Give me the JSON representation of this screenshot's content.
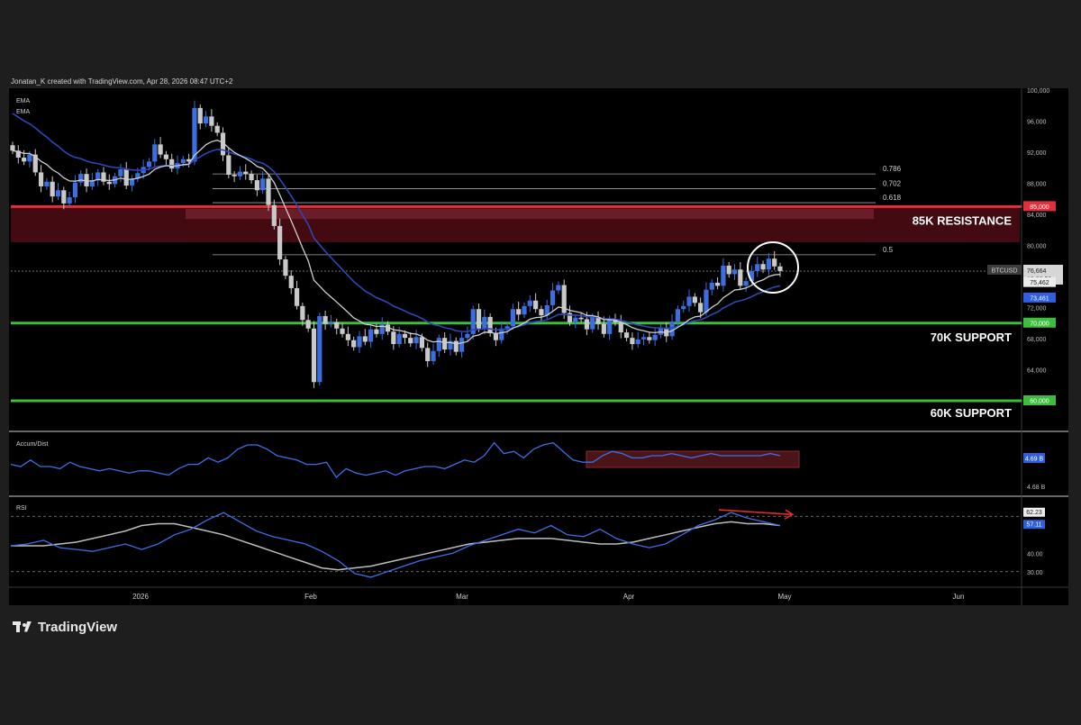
{
  "header": {
    "attribution": "Jonatan_K created with TradingView.com, Apr 28, 2026 08:47 UTC+2",
    "ema1_label": "EMA",
    "ema2_label": "EMA"
  },
  "brand": {
    "name": "TradingView"
  },
  "colors": {
    "background": "#000000",
    "frame": "#1e1e1f",
    "up": "#3b6fe0",
    "down": "#c9c9c9",
    "ema_fast": "#cfcfcf",
    "ema_slow": "#2f45b8",
    "resistance": "#e0303c",
    "resistance_zone": "#5a0f17",
    "support": "#3dbd3d",
    "acc_line": "#3a6fe8",
    "rsi_line": "#3a6fe8",
    "rsi_ma": "#bdbdbd",
    "annotation": "#ffffff",
    "divergence_arrow": "#e02b2b"
  },
  "price_axis": {
    "ticks": [
      "100,000",
      "96,000",
      "92,000",
      "88,000",
      "84,000",
      "80,000",
      "76,000",
      "72,000",
      "68,000",
      "64,000",
      "60,000"
    ],
    "resistance_badge": "85,000",
    "support70_badge": "70,000",
    "support60_badge": "60,000",
    "symbol_badge": "BTCUSD",
    "price_badge": "76,664",
    "countdown": "12:03:52",
    "ema_fast_badge": "75,462",
    "ema_slow_badge": "73,461"
  },
  "x_axis": {
    "labels": [
      "2026",
      "Feb",
      "Mar",
      "Apr",
      "May",
      "Jun"
    ]
  },
  "levels": {
    "resistance_label": "85K RESISTANCE",
    "support70_label": "70K SUPPORT",
    "support60_label": "60K SUPPORT"
  },
  "acc_panel": {
    "label": "Accum/Dist",
    "value_badge": "4.69 B",
    "lower_tick": "4.68 B"
  },
  "rsi_panel": {
    "label": "RSI",
    "value_badge1": "62.23",
    "value_badge2": "57.11",
    "ticks": [
      "60.00",
      "40.00",
      "30.00"
    ]
  },
  "chart_data": [
    {
      "type": "candlestick",
      "symbol": "BTCUSD",
      "x_labels": [
        "2026",
        "Feb",
        "Mar",
        "Apr",
        "May",
        "Jun"
      ],
      "ylim": [
        58000,
        102000
      ],
      "y_ticks": [
        100000,
        96000,
        92000,
        88000,
        84000,
        80000,
        76000,
        72000,
        68000,
        64000,
        60000
      ],
      "close": [
        92200,
        91300,
        90800,
        91700,
        89400,
        87600,
        88200,
        86300,
        87100,
        85400,
        86200,
        88100,
        89200,
        87600,
        88400,
        89400,
        88200,
        87900,
        88900,
        89800,
        87700,
        88600,
        89300,
        90100,
        90800,
        93000,
        91700,
        91100,
        89900,
        90600,
        91100,
        90800,
        97700,
        95700,
        96600,
        95400,
        94500,
        91600,
        89100,
        88900,
        89500,
        89200,
        88400,
        87100,
        88600,
        85200,
        82500,
        78200,
        76100,
        74500,
        72200,
        70400,
        69300,
        62400,
        70900,
        69900,
        70100,
        69300,
        68600,
        67800,
        66900,
        68300,
        67600,
        69200,
        68600,
        69800,
        68900,
        67300,
        68600,
        68100,
        67400,
        68200,
        66800,
        65100,
        66400,
        68100,
        66600,
        67700,
        66300,
        68100,
        68600,
        71800,
        69300,
        70800,
        68700,
        67800,
        69300,
        69600,
        71800,
        71100,
        72200,
        72900,
        71800,
        71000,
        72300,
        74200,
        74900,
        71300,
        70100,
        70700,
        70500,
        69200,
        70800,
        69900,
        68600,
        70500,
        70100,
        68800,
        68100,
        67300,
        67900,
        68200,
        67800,
        68500,
        69400,
        68300,
        70200,
        71800,
        72200,
        73400,
        72600,
        71400,
        74300,
        75200,
        74800,
        77400,
        76300,
        76900,
        74800,
        75400,
        76700,
        77600,
        76900,
        78300,
        77300,
        76700
      ],
      "resistance": 85000,
      "supports": [
        70000,
        60000
      ],
      "fib_levels": [
        {
          "label": "0.786",
          "price": 89200
        },
        {
          "label": "0.702",
          "price": 87300
        },
        {
          "label": "0.618",
          "price": 85500
        },
        {
          "label": "0.5",
          "price": 78800
        }
      ],
      "annotations": [
        "85K RESISTANCE",
        "70K SUPPORT",
        "60K SUPPORT"
      ]
    },
    {
      "type": "line",
      "name": "Accum/Dist",
      "values": [
        0.6,
        0.5,
        0.8,
        0.5,
        0.5,
        0.4,
        0.7,
        0.5,
        0.4,
        0.3,
        0.4,
        0.3,
        0.2,
        0.3,
        0.3,
        0.2,
        0.1,
        0.4,
        0.6,
        0.6,
        0.9,
        0.7,
        0.9,
        1.3,
        1.5,
        1.5,
        1.3,
        1.0,
        0.9,
        0.8,
        0.6,
        0.6,
        0.7,
        0.0,
        0.4,
        0.2,
        0.1,
        0.2,
        0.3,
        0.1,
        0.3,
        0.4,
        0.5,
        0.5,
        0.4,
        0.6,
        0.8,
        0.7,
        1.0,
        1.6,
        1.1,
        1.2,
        0.9,
        1.3,
        1.5,
        1.6,
        1.2,
        0.8,
        0.7,
        0.7,
        1.0,
        1.2,
        1.1,
        0.9,
        0.9,
        1.0,
        1.0,
        1.1,
        1.0,
        0.9,
        1.0,
        1.1,
        1.0,
        1.0,
        1.0,
        1.0,
        1.0,
        1.1,
        1.0
      ]
    },
    {
      "type": "line",
      "name": "RSI",
      "ylim": [
        25,
        65
      ],
      "y_ticks": [
        60,
        40,
        30
      ],
      "rsi": [
        44,
        45,
        47,
        43,
        42,
        41,
        43,
        45,
        42,
        45,
        50,
        53,
        58,
        62,
        57,
        52,
        49,
        47,
        45,
        41,
        36,
        29,
        27,
        30,
        33,
        36,
        38,
        40,
        44,
        47,
        50,
        53,
        51,
        55,
        50,
        49,
        53,
        48,
        45,
        43,
        45,
        50,
        55,
        58,
        62,
        59,
        57,
        55
      ],
      "rsi_ma": [
        44,
        44,
        44,
        45,
        46,
        48,
        50,
        52,
        55,
        56,
        56,
        54,
        52,
        50,
        47,
        44,
        41,
        38,
        35,
        32,
        31,
        32,
        33,
        35,
        37,
        39,
        41,
        43,
        45,
        46,
        47,
        48,
        48,
        48,
        47,
        46,
        45,
        45,
        46,
        48,
        50,
        52,
        54,
        56,
        57,
        56,
        56,
        55
      ]
    }
  ]
}
